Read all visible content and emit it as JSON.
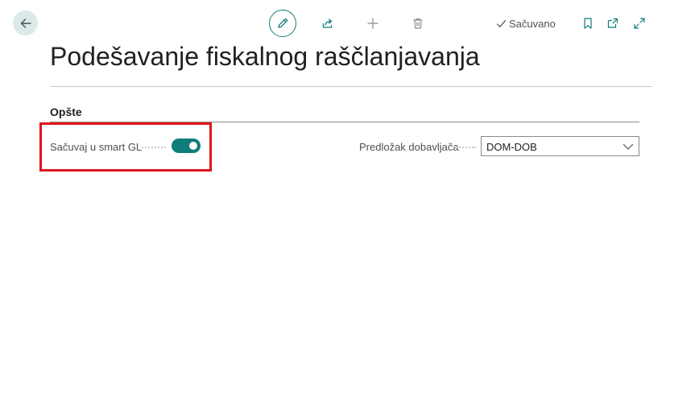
{
  "page": {
    "title": "Podešavanje fiskalnog raščlanjavanja",
    "saved_status": "Sačuvano"
  },
  "toolbar": {
    "icons": [
      "back-arrow-icon",
      "pencil-icon",
      "share-icon",
      "plus-icon",
      "trash-icon",
      "check-icon",
      "bookmark-icon",
      "open-new-window-icon",
      "expand-icon"
    ]
  },
  "section": {
    "title": "Opšte"
  },
  "fields": {
    "smart_gl": {
      "label": "Sačuvaj u smart GL",
      "value": true
    },
    "vendor_template": {
      "label": "Predložak dobavljača",
      "value": "DOM-DOB"
    }
  },
  "colors": {
    "accent": "#0f7d7a",
    "back_button_bg": "#dcebea",
    "highlight": "#e0151b"
  }
}
